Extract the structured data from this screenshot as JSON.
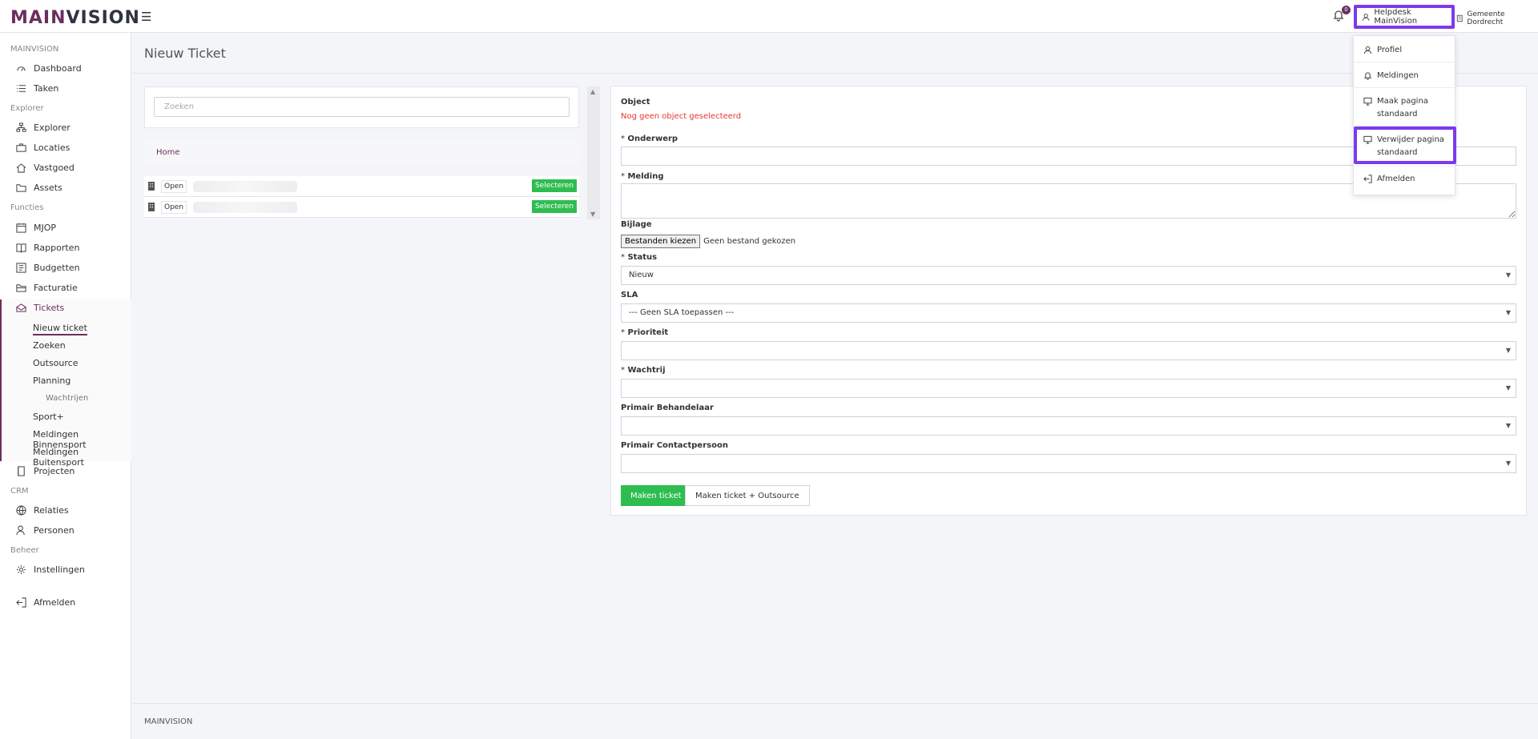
{
  "app": {
    "logo_part1": "MAIN",
    "logo_part2": "VISION"
  },
  "header": {
    "notification_count": "0",
    "user_label": "Helpdesk MainVision",
    "org_label": "Gemeente Dordrecht"
  },
  "user_menu": {
    "items": [
      {
        "label": "Profiel",
        "icon": "user-icon"
      },
      {
        "label": "Meldingen",
        "icon": "bell-icon"
      },
      {
        "label": "Maak pagina standaard",
        "icon": "monitor-icon"
      },
      {
        "label": "Verwijder pagina standaard",
        "icon": "monitor-icon"
      },
      {
        "label": "Afmelden",
        "icon": "logout-icon"
      }
    ]
  },
  "sidebar": {
    "sec_mainvision": "MAINVISION",
    "dashboard": "Dashboard",
    "taken": "Taken",
    "sec_explorer": "Explorer",
    "explorer": "Explorer",
    "locaties": "Locaties",
    "vastgoed": "Vastgoed",
    "assets": "Assets",
    "sec_functies": "Functies",
    "mjop": "MJOP",
    "rapporten": "Rapporten",
    "budgetten": "Budgetten",
    "facturatie": "Facturatie",
    "tickets": "Tickets",
    "nieuw_ticket": "Nieuw ticket",
    "zoeken": "Zoeken",
    "outsource": "Outsource",
    "planning": "Planning",
    "wachtrijen": "Wachtrijen",
    "sport": "Sport+",
    "meldingen_binnensport": "Meldingen Binnensport",
    "meldingen_buitensport": "Meldingen Buitensport",
    "projecten": "Projecten",
    "sec_crm": "CRM",
    "relaties": "Relaties",
    "personen": "Personen",
    "sec_beheer": "Beheer",
    "instellingen": "Instellingen",
    "afmelden": "Afmelden"
  },
  "page": {
    "title": "Nieuw Ticket",
    "footer": "MAINVISION"
  },
  "object_browser": {
    "search_placeholder": "Zoeken",
    "breadcrumb_home": "Home",
    "rows": [
      {
        "status": "Open",
        "button": "Selecteren"
      },
      {
        "status": "Open",
        "button": "Selecteren"
      }
    ]
  },
  "form": {
    "object_label": "Object",
    "object_error": "Nog geen object geselecteerd",
    "required_mark": "*",
    "onderwerp_label": "Onderwerp",
    "melding_label": "Melding",
    "bijlage_label": "Bijlage",
    "file_button": "Bestanden kiezen",
    "file_none": "Geen bestand gekozen",
    "status_label": "Status",
    "status_value": "Nieuw",
    "sla_label": "SLA",
    "sla_value": "--- Geen SLA toepassen ---",
    "prioriteit_label": "Prioriteit",
    "prioriteit_value": "",
    "wachtrij_label": "Wachtrij",
    "wachtrij_value": "",
    "behandelaar_label": "Primair Behandelaar",
    "behandelaar_value": "",
    "contactpersoon_label": "Primair Contactpersoon",
    "contactpersoon_value": "",
    "submit_label": "Maken ticket",
    "submit_outsource_label": "Maken ticket + Outsource"
  },
  "colors": {
    "brand": "#6b2f5e",
    "highlight": "#7c3aed",
    "success": "#2ebd50",
    "error": "#e53935"
  }
}
